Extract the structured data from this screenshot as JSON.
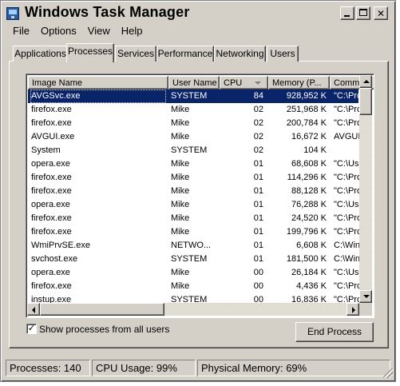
{
  "window": {
    "title": "Windows Task Manager"
  },
  "menu": [
    "File",
    "Options",
    "View",
    "Help"
  ],
  "tabs": [
    "Applications",
    "Processes",
    "Services",
    "Performance",
    "Networking",
    "Users"
  ],
  "active_tab": "Processes",
  "columns": [
    "Image Name",
    "User Name",
    "CPU",
    "Memory (P...",
    "Comma"
  ],
  "processes": [
    {
      "name": "AVGSvc.exe",
      "user": "SYSTEM",
      "cpu": "84",
      "mem": "928,952 K",
      "cmd": "\"C:\\Pro"
    },
    {
      "name": "firefox.exe",
      "user": "Mike",
      "cpu": "02",
      "mem": "251,968 K",
      "cmd": "\"C:\\Pro"
    },
    {
      "name": "firefox.exe",
      "user": "Mike",
      "cpu": "02",
      "mem": "200,784 K",
      "cmd": "\"C:\\Pro"
    },
    {
      "name": "AVGUI.exe",
      "user": "Mike",
      "cpu": "02",
      "mem": "16,672 K",
      "cmd": "AVGUI"
    },
    {
      "name": "System",
      "user": "SYSTEM",
      "cpu": "02",
      "mem": "104 K",
      "cmd": ""
    },
    {
      "name": "opera.exe",
      "user": "Mike",
      "cpu": "01",
      "mem": "68,608 K",
      "cmd": "\"C:\\Us"
    },
    {
      "name": "firefox.exe",
      "user": "Mike",
      "cpu": "01",
      "mem": "114,296 K",
      "cmd": "\"C:\\Pro"
    },
    {
      "name": "firefox.exe",
      "user": "Mike",
      "cpu": "01",
      "mem": "88,128 K",
      "cmd": "\"C:\\Pro"
    },
    {
      "name": "opera.exe",
      "user": "Mike",
      "cpu": "01",
      "mem": "76,288 K",
      "cmd": "\"C:\\Us"
    },
    {
      "name": "firefox.exe",
      "user": "Mike",
      "cpu": "01",
      "mem": "24,520 K",
      "cmd": "\"C:\\Pro"
    },
    {
      "name": "firefox.exe",
      "user": "Mike",
      "cpu": "01",
      "mem": "199,796 K",
      "cmd": "\"C:\\Pro"
    },
    {
      "name": "WmiPrvSE.exe",
      "user": "NETWO...",
      "cpu": "01",
      "mem": "6,608 K",
      "cmd": "C:\\Win"
    },
    {
      "name": "svchost.exe",
      "user": "SYSTEM",
      "cpu": "01",
      "mem": "181,500 K",
      "cmd": "C:\\Win"
    },
    {
      "name": "opera.exe",
      "user": "Mike",
      "cpu": "00",
      "mem": "26,184 K",
      "cmd": "\"C:\\Us"
    },
    {
      "name": "firefox.exe",
      "user": "Mike",
      "cpu": "00",
      "mem": "4,436 K",
      "cmd": "\"C:\\Pro"
    },
    {
      "name": "instup.exe",
      "user": "SYSTEM",
      "cpu": "00",
      "mem": "16,836 K",
      "cmd": "\"C:\\Pro"
    }
  ],
  "show_all_label": "Show processes from all users",
  "show_all_checked": true,
  "end_process_label": "End Process",
  "status": {
    "processes": "Processes: 140",
    "cpu": "CPU Usage: 99%",
    "memory": "Physical Memory: 69%"
  }
}
